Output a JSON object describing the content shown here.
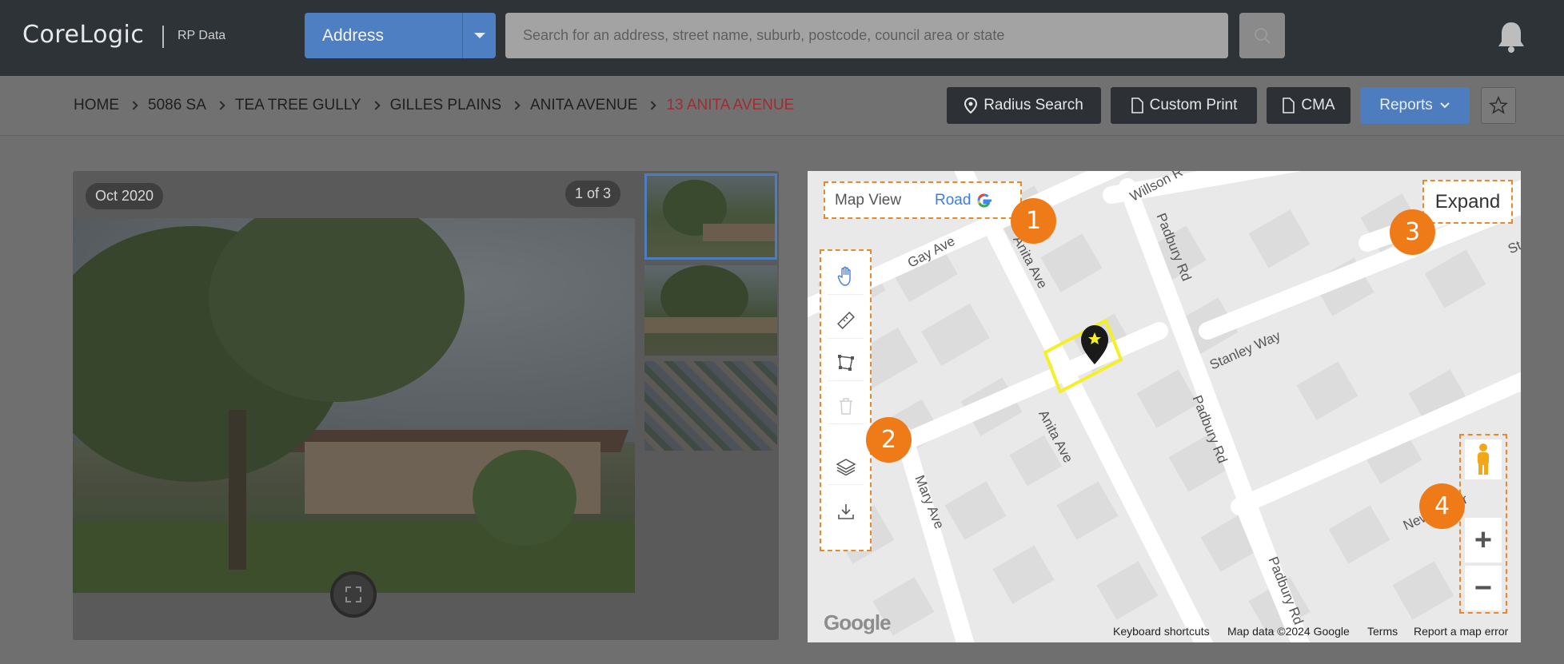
{
  "header": {
    "brand": "CoreLogic",
    "brand_sub": "RP Data",
    "search_type": "Address",
    "search_placeholder": "Search for an address, street name, suburb, postcode, council area or state",
    "icons": [
      "search-icon",
      "bell-icon",
      "chevron-down-icon"
    ]
  },
  "breadcrumb": {
    "items": [
      "HOME",
      "5086 SA",
      "TEA TREE GULLY",
      "GILLES PLAINS",
      "ANITA AVENUE"
    ],
    "current": "13 ANITA AVENUE"
  },
  "toolbar": {
    "radius_search": "Radius Search",
    "custom_print": "Custom Print",
    "cma": "CMA",
    "reports": "Reports"
  },
  "photos": {
    "date": "Oct 2020",
    "count": "1 of 3",
    "thumb_count": 3
  },
  "map": {
    "view_label": "Map View",
    "type": "Road",
    "expand": "Expand",
    "zoom_in": "+",
    "zoom_out": "−",
    "streets": [
      "Willson R",
      "Gay Ave",
      "Anita Ave",
      "Padbury Rd",
      "Stanley Way",
      "Anita Ave",
      "Padbury Rd",
      "Mary Ave",
      "New Bie Dr",
      "Padbury Rd",
      "St"
    ],
    "attribution": {
      "keyboard": "Keyboard shortcuts",
      "data": "Map data ©2024 Google",
      "terms": "Terms",
      "report": "Report a map error"
    },
    "google": "Google",
    "tools": [
      "hand-icon",
      "ruler-icon",
      "polygon-icon",
      "trash-icon",
      "layers-icon",
      "download-icon"
    ]
  },
  "callouts": [
    "1",
    "2",
    "3",
    "4"
  ],
  "colors": {
    "accent_blue": "#4e7dbf",
    "callout_orange": "#ee7a18",
    "breadcrumb_current": "#9b2f33",
    "parcel_outline": "#f3f02a"
  }
}
